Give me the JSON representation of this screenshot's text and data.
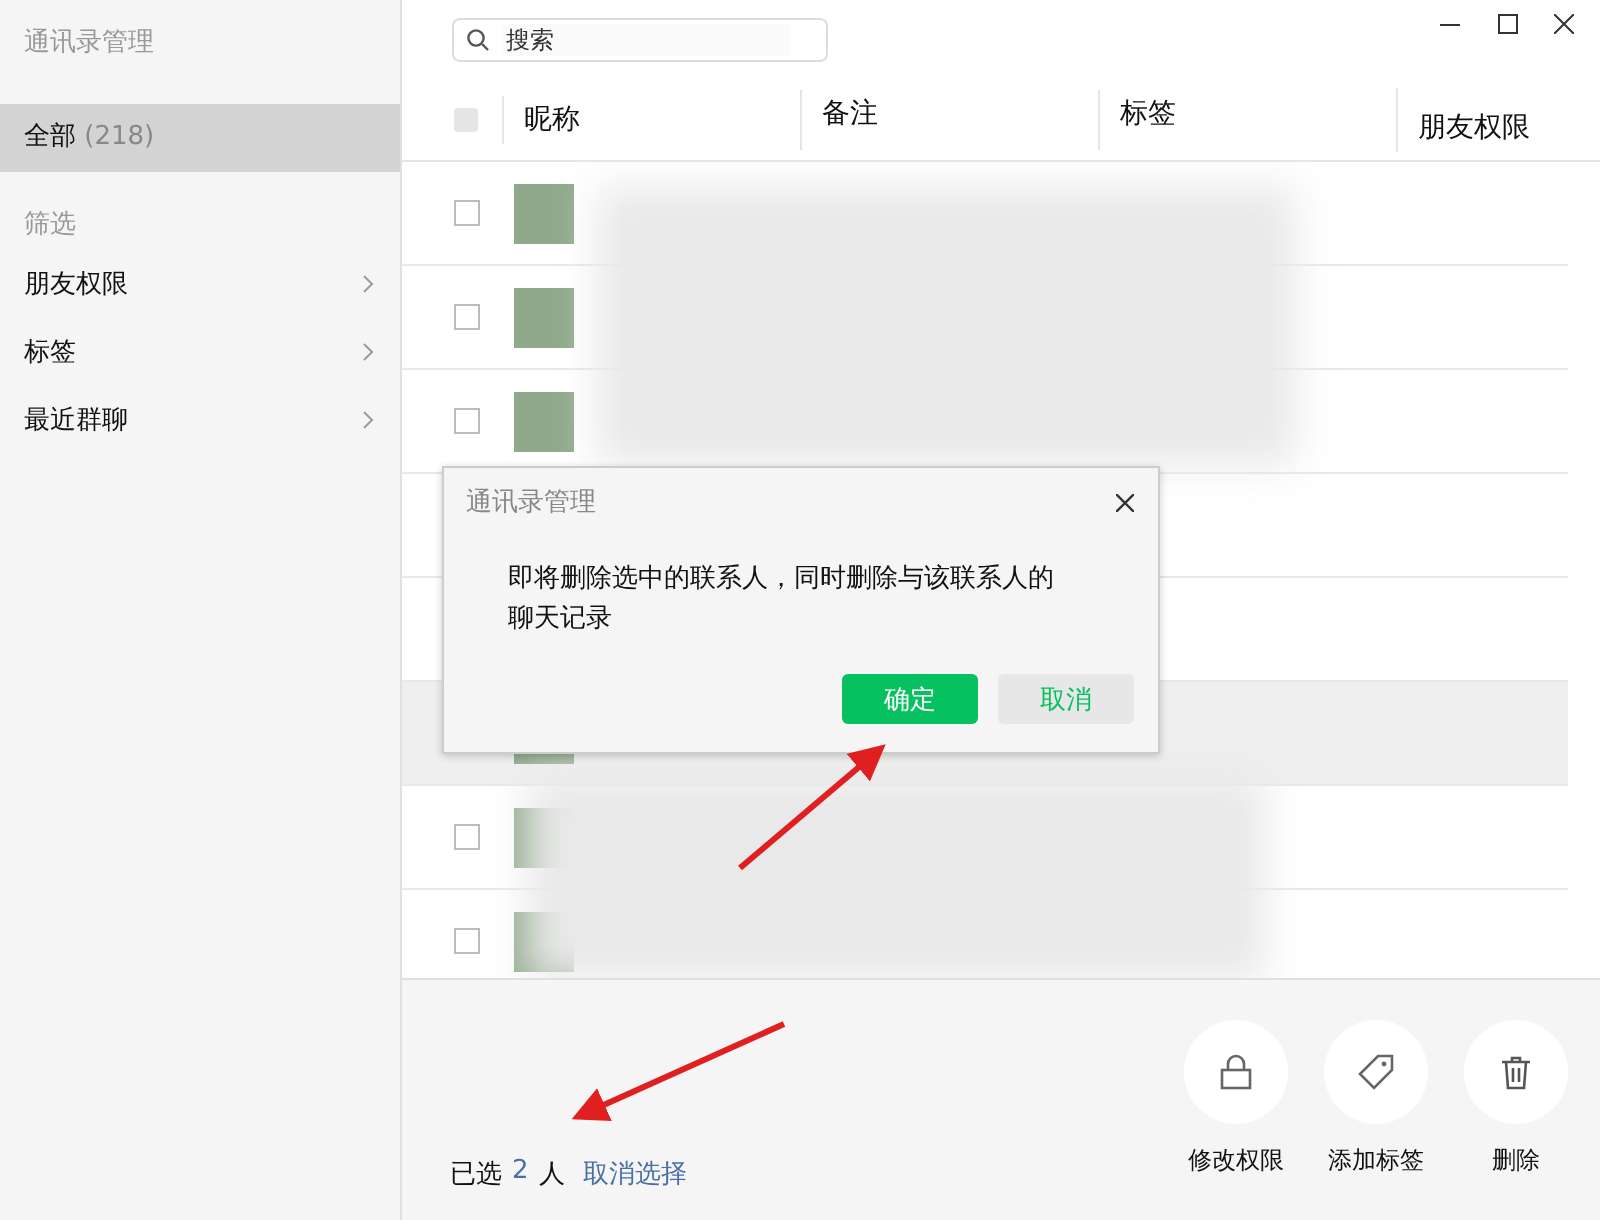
{
  "sidebar": {
    "title": "通讯录管理",
    "items": [
      {
        "label": "全部",
        "count": "(218)",
        "selected": true
      }
    ],
    "filter_heading": "筛选",
    "filters": [
      {
        "label": "朋友权限"
      },
      {
        "label": "标签"
      },
      {
        "label": "最近群聊"
      }
    ]
  },
  "search": {
    "placeholder": "搜索"
  },
  "table": {
    "select_all": {
      "indeterminate": true
    },
    "columns": [
      "昵称",
      "备注",
      "标签",
      "朋友权限"
    ],
    "rows": [
      {
        "kind": "contact",
        "checked": false,
        "selected": false
      },
      {
        "kind": "contact",
        "checked": false,
        "selected": false
      },
      {
        "kind": "contact",
        "checked": false,
        "selected": false
      },
      {
        "kind": "covered",
        "selected": false
      },
      {
        "kind": "covered",
        "selected": false
      },
      {
        "kind": "covered",
        "selected": true
      },
      {
        "kind": "contact",
        "checked": false,
        "selected": false
      },
      {
        "kind": "contact",
        "checked": false,
        "selected": false
      }
    ]
  },
  "footer": {
    "prefix": "已选",
    "count": "2",
    "suffix": "人",
    "clear": "取消选择",
    "actions": [
      {
        "kind": "lock",
        "label": "修改权限"
      },
      {
        "kind": "tag",
        "label": "添加标签"
      },
      {
        "kind": "trash",
        "label": "删除"
      }
    ]
  },
  "dialog": {
    "title": "通讯录管理",
    "message": "即将删除选中的联系人，同时删除与该联系人的聊天记录",
    "buttons": [
      {
        "label": "确定",
        "primary": true
      },
      {
        "label": "取消",
        "primary": false
      }
    ]
  }
}
